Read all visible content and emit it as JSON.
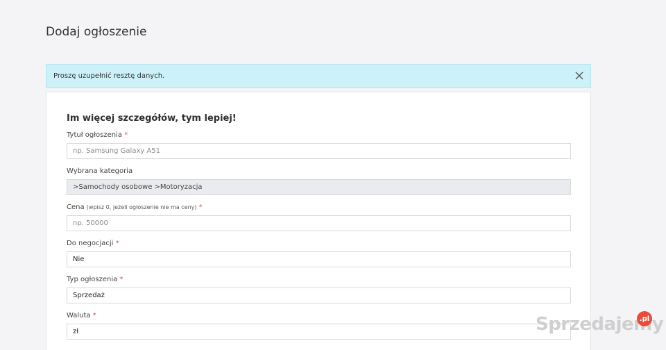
{
  "page": {
    "title": "Dodaj ogłoszenie"
  },
  "alert": {
    "message": "Proszę uzupełnić resztę danych.",
    "close_icon": "close-icon"
  },
  "form": {
    "heading": "Im więcej szczegółów, tym lepiej!",
    "required_mark": "*",
    "title_field": {
      "label": "Tytuł ogłoszenia",
      "placeholder": "np. Samsung Galaxy A51"
    },
    "category_field": {
      "label": "Wybrana kategoria",
      "value": ">Samochody osobowe >Motoryzacja"
    },
    "price_field": {
      "label": "Cena",
      "hint": "(wpisz 0, jeżeli ogłoszenie nie ma ceny)",
      "placeholder": "np. 50000"
    },
    "negotiation_field": {
      "label": "Do negocjacji",
      "value": "Nie"
    },
    "type_field": {
      "label": "Typ ogłoszenia",
      "value": "Sprzedaż"
    },
    "currency_field": {
      "label": "Waluta",
      "value": "zł"
    }
  },
  "watermark": {
    "text": "Sprzedajemy",
    "badge": ".pl"
  },
  "colors": {
    "alert_bg": "#cdf1f8",
    "required": "#d9534f",
    "badge": "#ea4c3a"
  }
}
